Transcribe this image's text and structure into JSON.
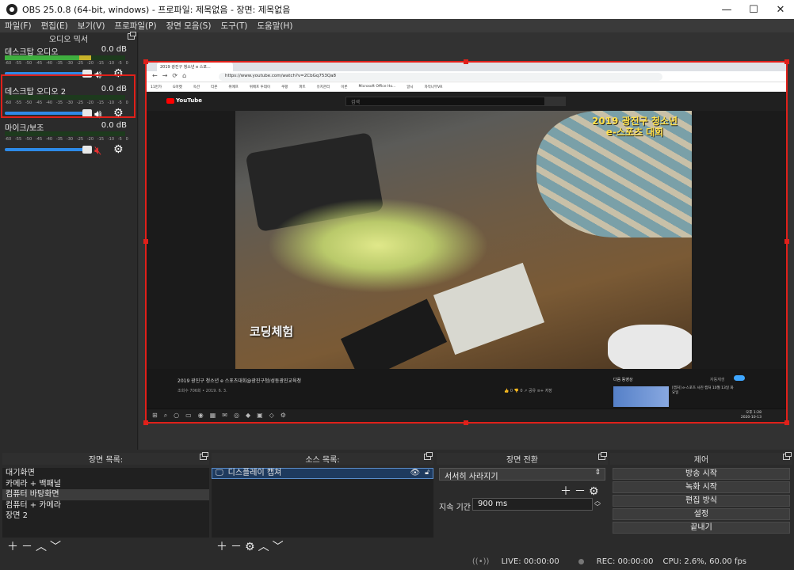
{
  "window": {
    "title": "OBS 25.0.8 (64-bit, windows) - 프로파일: 제목없음 - 장면: 제목없음",
    "minimize": "—",
    "maximize": "☐",
    "close": "✕"
  },
  "menu": [
    "파일(F)",
    "편집(E)",
    "보기(V)",
    "프로파일(P)",
    "장면 모음(S)",
    "도구(T)",
    "도움말(H)"
  ],
  "mixer": {
    "title": "오디오 믹서",
    "ticks": [
      "-60",
      "-55",
      "-50",
      "-45",
      "-40",
      "-35",
      "-30",
      "-25",
      "-20",
      "-15",
      "-10",
      "-5",
      "0"
    ],
    "channels": [
      {
        "name": "데스크탑 오디오",
        "db": "0.0 dB",
        "muted": false,
        "level": 0.72
      },
      {
        "name": "데스크탑 오디오 2",
        "db": "0.0 dB",
        "muted": false,
        "level": 0
      },
      {
        "name": "마이크/보조",
        "db": "0.0 dB",
        "muted": true,
        "level": 0
      }
    ]
  },
  "preview": {
    "browser": {
      "tab": "2019 광진구 청소년 e 스포...",
      "url": "https://www.youtube.com/watch?v=2CbGq753Qa8",
      "bookmarks": [
        "11번가",
        "G마켓",
        "옥션",
        "티몬",
        "위메프",
        "위메프 투데이",
        "쿠팡",
        "파트",
        "유지관리",
        "이론",
        "Microsoft Office Ho...",
        "알시",
        "자막나무VR"
      ]
    },
    "youtube": {
      "logo": "YouTube",
      "search_placeholder": "검색",
      "video_overlay_title_1": "2019 광진구 청소년",
      "video_overlay_title_2": "e-스포츠 대회",
      "watermark": "코딩체험",
      "video_title": "2019 광진구 청소년 e 스포츠대회@광진구청/성동광진교육청",
      "views": "조회수 706회 • 2019. 6. 3.",
      "actions": "👍 0   👎 0   ↗ 공유   ≡+ 저장",
      "next_label": "다음 동영상",
      "autoplay_label": "자동재생",
      "next_thumb_text": "[캡처] e-스포츠 사진 캡처 10월 13일 화요일",
      "taskbar_time": "오후 1:28",
      "taskbar_date": "2020-10-13"
    }
  },
  "scenes": {
    "title": "장면 목록:",
    "items": [
      "대기화면",
      "카메라 + 백패널",
      "컴퓨터 바탕화면",
      "컴퓨터 + 카메라",
      "장면 2"
    ],
    "selected_index": 2
  },
  "sources": {
    "title": "소스 목록:",
    "items": [
      {
        "name": "디스플레이 캡쳐",
        "visible": true,
        "locked": false
      }
    ]
  },
  "transitions": {
    "title": "장면 전환",
    "selected": "서서히 사라지기",
    "duration_label": "지속 기간",
    "duration": "900 ms"
  },
  "controls": {
    "title": "제어",
    "buttons": [
      "방송 시작",
      "녹화 시작",
      "편집 방식",
      "설정",
      "끝내기"
    ]
  },
  "status": {
    "live": "LIVE: 00:00:00",
    "rec": "REC: 00:00:00",
    "cpu": "CPU: 2.6%, 60.00 fps"
  },
  "colors": {
    "accent": "#2d8ae8",
    "selection": "#e0201a"
  }
}
